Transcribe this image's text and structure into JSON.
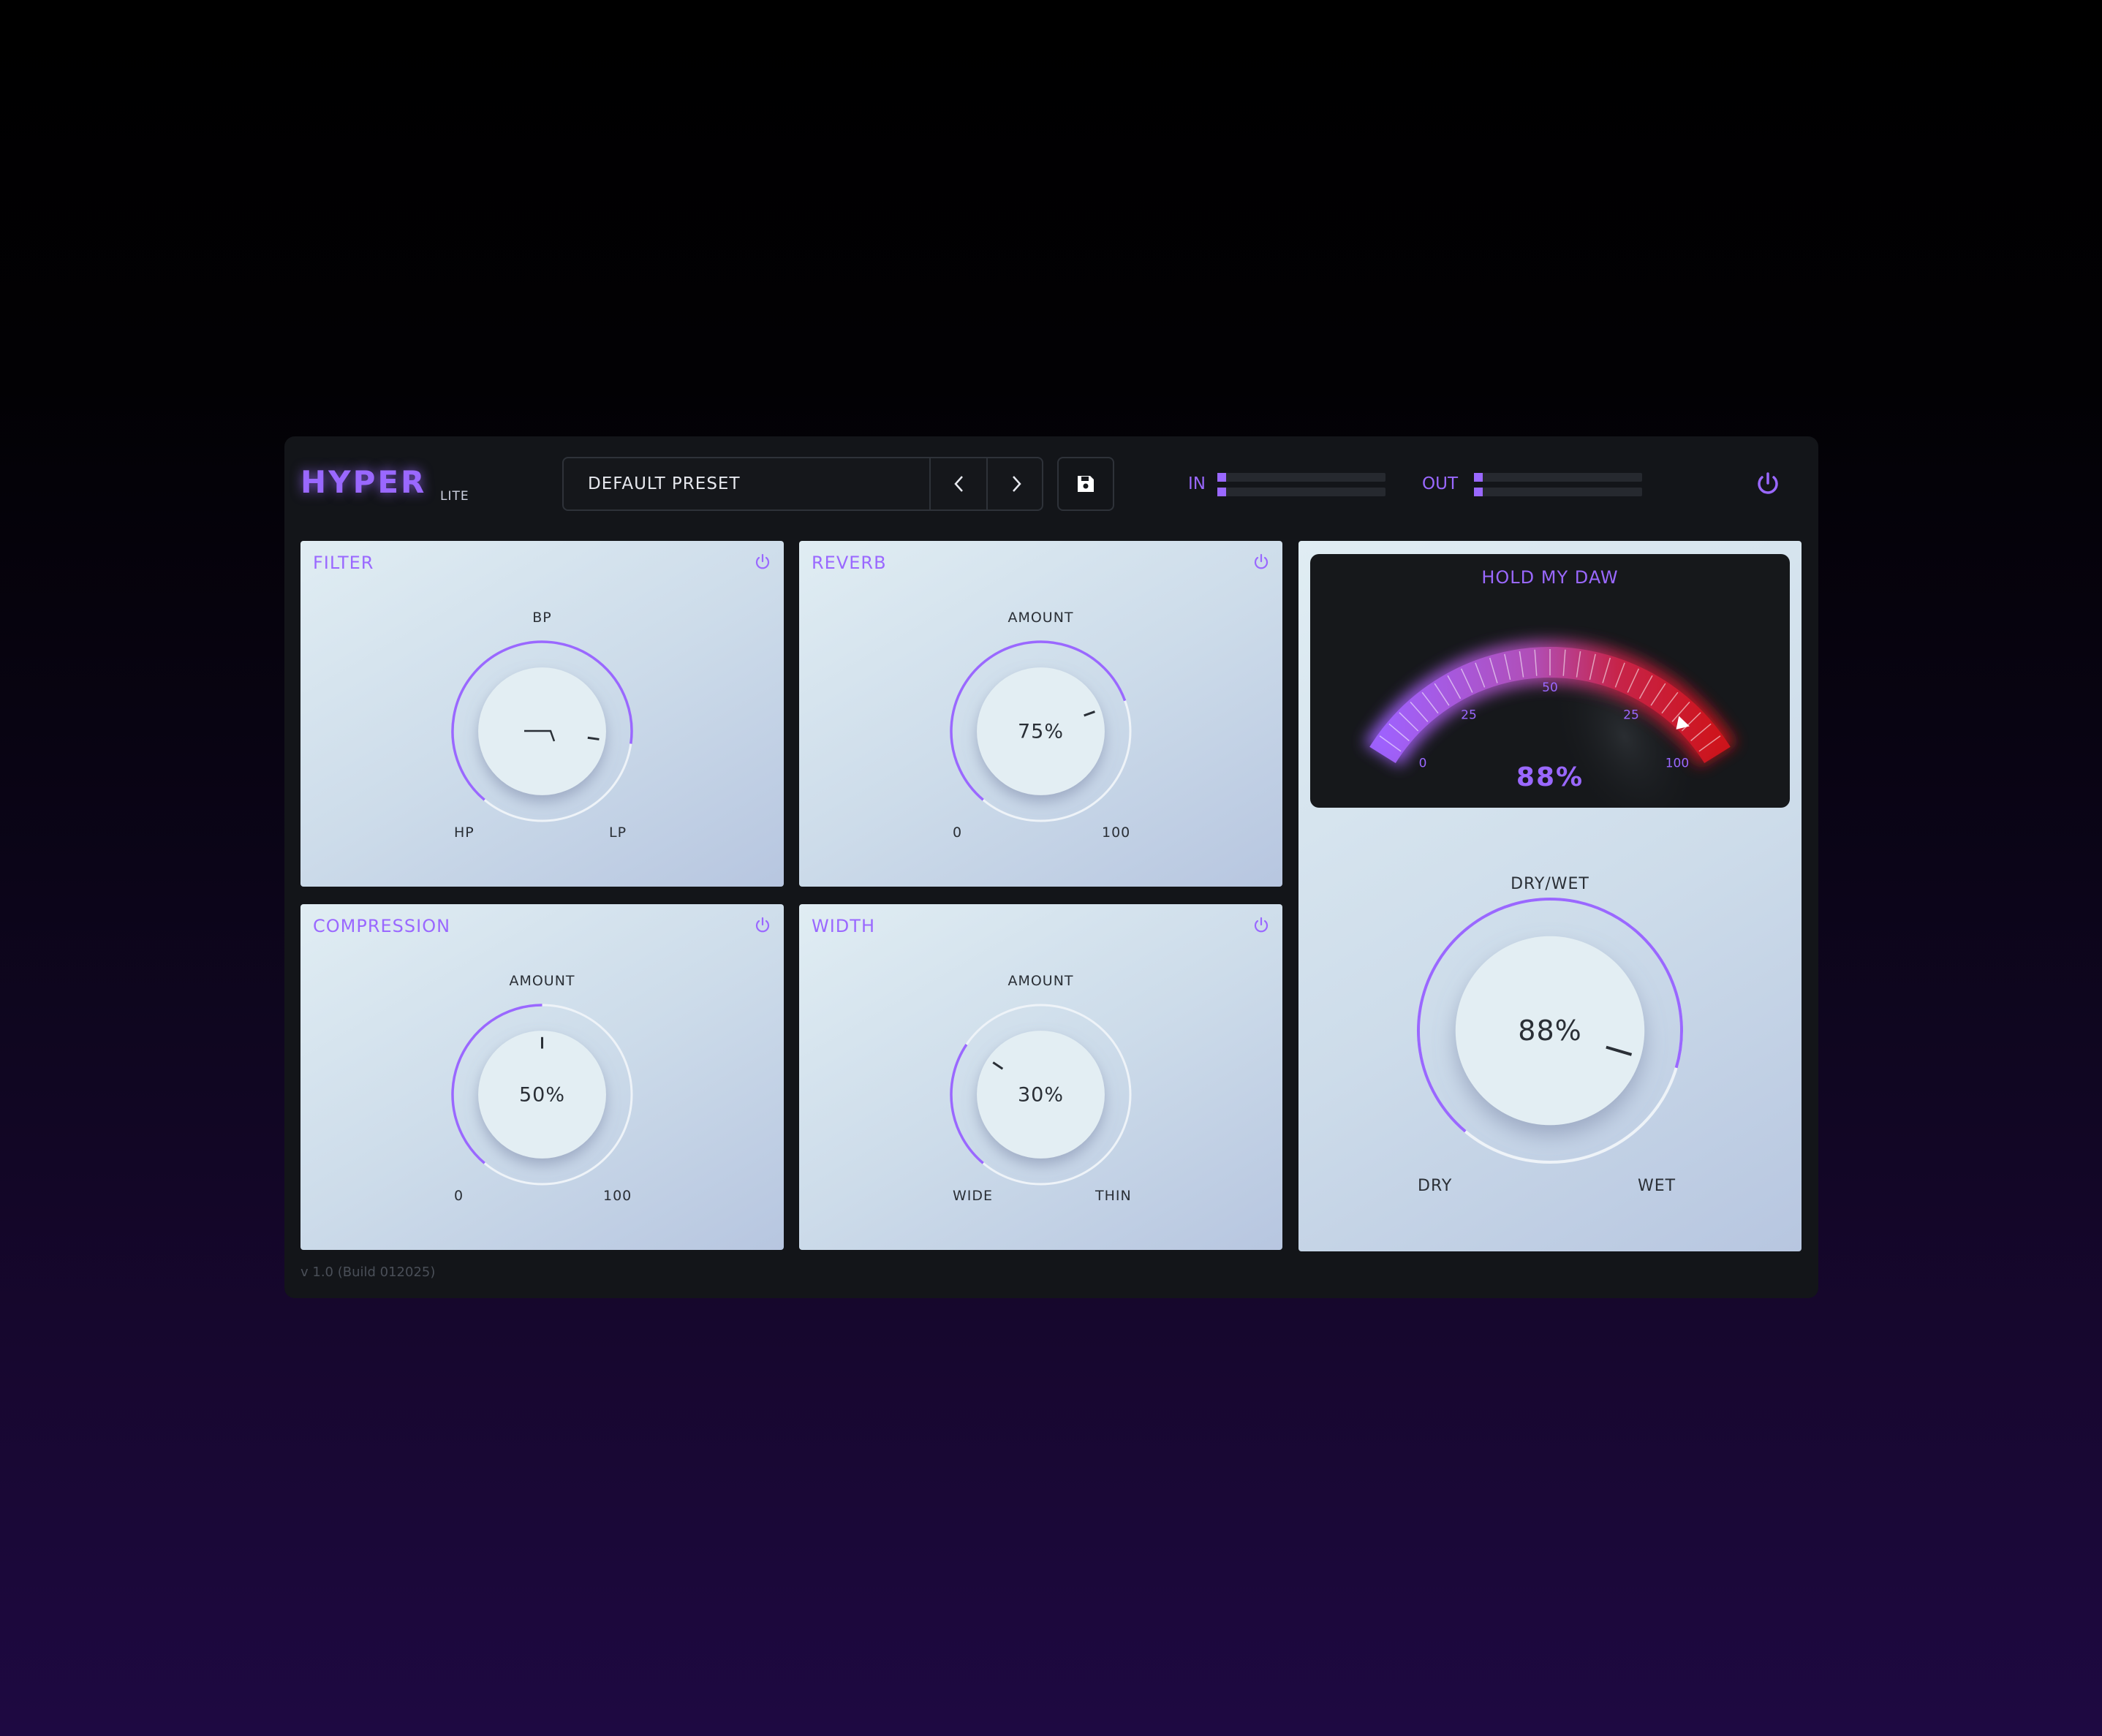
{
  "brand": {
    "name": "HYPER",
    "edition": "LITE"
  },
  "preset": {
    "name": "DEFAULT PRESET",
    "prev_icon": "chevron-left-icon",
    "next_icon": "chevron-right-icon",
    "save_icon": "floppy-disk-icon"
  },
  "meters": {
    "input": {
      "label": "IN",
      "level": 0.05
    },
    "output": {
      "label": "OUT",
      "level": 0.05
    }
  },
  "modules": {
    "filter": {
      "title": "FILTER",
      "top_label": "BP",
      "left_label": "HP",
      "right_label": "LP",
      "value_fraction": 0.85,
      "center_icon": "filter-curve-icon"
    },
    "reverb": {
      "title": "REVERB",
      "top_label": "AMOUNT",
      "left_label": "0",
      "right_label": "100",
      "value_text": "75%",
      "value": 75
    },
    "compression": {
      "title": "COMPRESSION",
      "top_label": "AMOUNT",
      "left_label": "0",
      "right_label": "100",
      "value_text": "50%",
      "value": 50
    },
    "width": {
      "title": "WIDTH",
      "top_label": "AMOUNT",
      "left_label": "WIDE",
      "right_label": "THIN",
      "value_text": "30%",
      "value": 30
    }
  },
  "vu_meter": {
    "title": "HOLD MY DAW",
    "scale_labels": [
      "0",
      "25",
      "50",
      "25",
      "100"
    ],
    "value_text": "88%",
    "value": 88
  },
  "dry_wet": {
    "label": "DRY/WET",
    "left_label": "DRY",
    "right_label": "WET",
    "value_text": "88%",
    "value": 88
  },
  "footer": {
    "version": "v 1.0 (Build 012025)"
  },
  "colors": {
    "accent": "#9a68ff",
    "panel_bg": "#131519",
    "meter_red": "#c8141e"
  }
}
